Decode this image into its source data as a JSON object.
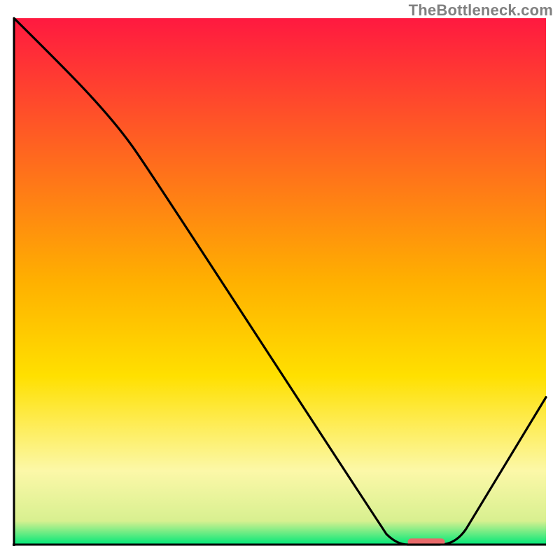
{
  "watermark": "TheBottleneck.com",
  "colors": {
    "red": "#ff1940",
    "yellow": "#ffe000",
    "pale_yellow": "#fcf8a8",
    "green": "#00e878",
    "curve": "#000000",
    "marker": "#e86a6a",
    "axis": "#000000"
  },
  "chart_data": {
    "type": "line",
    "title": "",
    "xlabel": "",
    "ylabel": "",
    "xlim": [
      0,
      100
    ],
    "ylim": [
      0,
      100
    ],
    "series": [
      {
        "name": "bottleneck-curve",
        "points": [
          {
            "x": 0,
            "y": 100
          },
          {
            "x": 18,
            "y": 80
          },
          {
            "x": 22,
            "y": 75
          },
          {
            "x": 70,
            "y": 2
          },
          {
            "x": 74,
            "y": 0
          },
          {
            "x": 80,
            "y": 0
          },
          {
            "x": 84,
            "y": 2
          },
          {
            "x": 100,
            "y": 28
          }
        ]
      }
    ],
    "marker": {
      "x_start": 74,
      "x_end": 81,
      "y": 0.5
    },
    "gradient_stops": [
      {
        "pos": 0.0,
        "color": "#ff1940"
      },
      {
        "pos": 0.5,
        "color": "#ffb000"
      },
      {
        "pos": 0.68,
        "color": "#ffe000"
      },
      {
        "pos": 0.86,
        "color": "#fcf8a8"
      },
      {
        "pos": 0.955,
        "color": "#d8f090"
      },
      {
        "pos": 1.0,
        "color": "#00e878"
      }
    ]
  }
}
